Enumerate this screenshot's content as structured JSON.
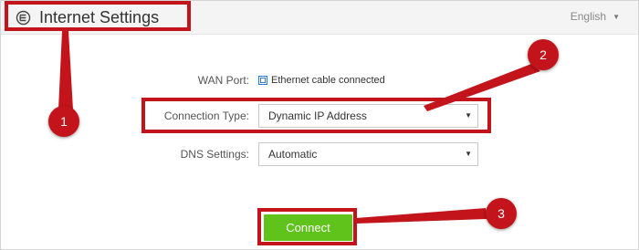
{
  "header": {
    "title": "Internet Settings",
    "icon": "globe-icon",
    "language": "English"
  },
  "form": {
    "wan_port": {
      "label": "WAN Port:",
      "status_icon": "checkbox-icon",
      "value": "Ethernet cable connected"
    },
    "connection_type": {
      "label": "Connection Type:",
      "selected": "Dynamic IP Address"
    },
    "dns_settings": {
      "label": "DNS Settings:",
      "selected": "Automatic"
    },
    "connect_label": "Connect"
  },
  "callouts": [
    "1",
    "2",
    "3"
  ],
  "colors": {
    "highlight": "#c4141b",
    "connect_button": "#5fc31c",
    "header_bg": "#f4f4f4"
  }
}
